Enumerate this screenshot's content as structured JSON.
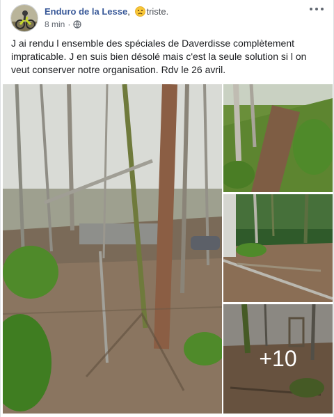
{
  "post": {
    "author": "Enduro de la Lesse",
    "author_separator": ",",
    "feeling": "triste.",
    "feeling_icon": "sad-face-emoji",
    "timestamp": "8 min",
    "separator": "·",
    "privacy_icon": "globe-icon",
    "text": "J ai rendu l ensemble des spéciales de Daverdisse complètement impraticable. J en suis bien désolé mais c'est la seule solution si l on veut conserver notre organisation. Rdv le 26 avril.",
    "more_photos_label": "+10"
  },
  "colors": {
    "author_link": "#385898",
    "meta_text": "#616770",
    "moss": "#4f8a2a",
    "bark": "#6b5a48"
  }
}
